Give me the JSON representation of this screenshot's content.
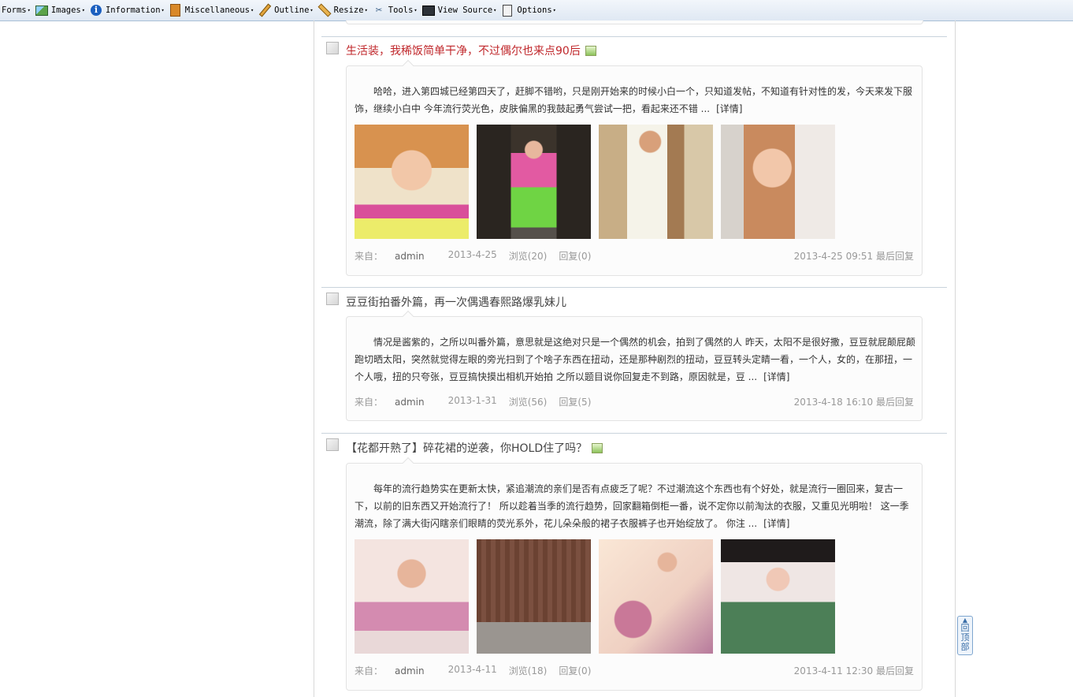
{
  "toolbar": {
    "items": [
      {
        "label": "Forms",
        "icon": "none"
      },
      {
        "label": "Images",
        "icon": "image-icon"
      },
      {
        "label": "Information",
        "icon": "info-icon"
      },
      {
        "label": "Miscellaneous",
        "icon": "misc-icon"
      },
      {
        "label": "Outline",
        "icon": "pencil-icon"
      },
      {
        "label": "Resize",
        "icon": "ruler-icon"
      },
      {
        "label": "Tools",
        "icon": "tools-icon"
      },
      {
        "label": "View Source",
        "icon": "source-icon"
      },
      {
        "label": "Options",
        "icon": "options-icon"
      }
    ]
  },
  "posts": [
    {
      "title": "生活装，我稀饭简单干净，不过偶尔也来点90后",
      "has_image_flag": true,
      "title_color": "#c0282c",
      "summary": "哈哈，进入第四城已经第四天了，赶脚不错哟，只是刚开始来的时候小白一个，只知道发帖，不知道有针对性的发，今天来发下服饰，继续小白中 今年流行荧光色，皮肤偏黑的我鼓起勇气尝试一把，看起来还不错 ...",
      "detail": "[详情]",
      "meta": {
        "author_prefix": "来自：",
        "author": "admin",
        "date": "2013-4-25",
        "views": "浏览(20)",
        "replies": "回复(0)",
        "last_reply": "2013-4-25 09:51 最后回复"
      }
    },
    {
      "title": "豆豆街拍番外篇，再一次偶遇春熙路爆乳妹儿",
      "has_image_flag": false,
      "title_color": "#444444",
      "summary": "情况是酱紫的，之所以叫番外篇，意思就是这绝对只是一个偶然的机会，拍到了偶然的人 昨天，太阳不是很好撒，豆豆就屁颠屁颠跑切晒太阳，突然就觉得左眼的旁光扫到了个啥子东西在扭动，还是那种剧烈的扭动，豆豆转头定睛一看，一个人，女的，在那扭，一个人哦，扭的只夸张，豆豆搞快摸出相机开始拍 之所以题目说你回复走不到路，原因就是，豆 ...",
      "detail": "[详情]",
      "meta": {
        "author_prefix": "来自：",
        "author": "admin",
        "date": "2013-1-31",
        "views": "浏览(56)",
        "replies": "回复(5)",
        "last_reply": "2013-4-18 16:10 最后回复"
      }
    },
    {
      "title": "【花都开熟了】碎花裙的逆袭，你HOLD住了吗？",
      "has_image_flag": true,
      "title_color": "#444444",
      "summary": "每年的流行趋势实在更新太快，紧追潮流的亲们是否有点疲乏了呢？不过潮流这个东西也有个好处，就是流行一圈回来，复古一下，以前的旧东西又开始流行了！ 所以趁着当季的流行趋势，回家翻箱倒柜一番，说不定你以前淘汰的衣服，又重见光明啦！ 这一季潮流，除了满大街闪瞎亲们眼睛的荧光系外，花儿朵朵般的裙子衣服裤子也开始绽放了。 你注 ...",
      "detail": "[详情]",
      "meta": {
        "author_prefix": "来自：",
        "author": "admin",
        "date": "2013-4-11",
        "views": "浏览(18)",
        "replies": "回复(0)",
        "last_reply": "2013-4-11 12:30 最后回复"
      }
    }
  ],
  "back_to_top": {
    "line1": "回",
    "line2": "顶",
    "line3": "部"
  }
}
